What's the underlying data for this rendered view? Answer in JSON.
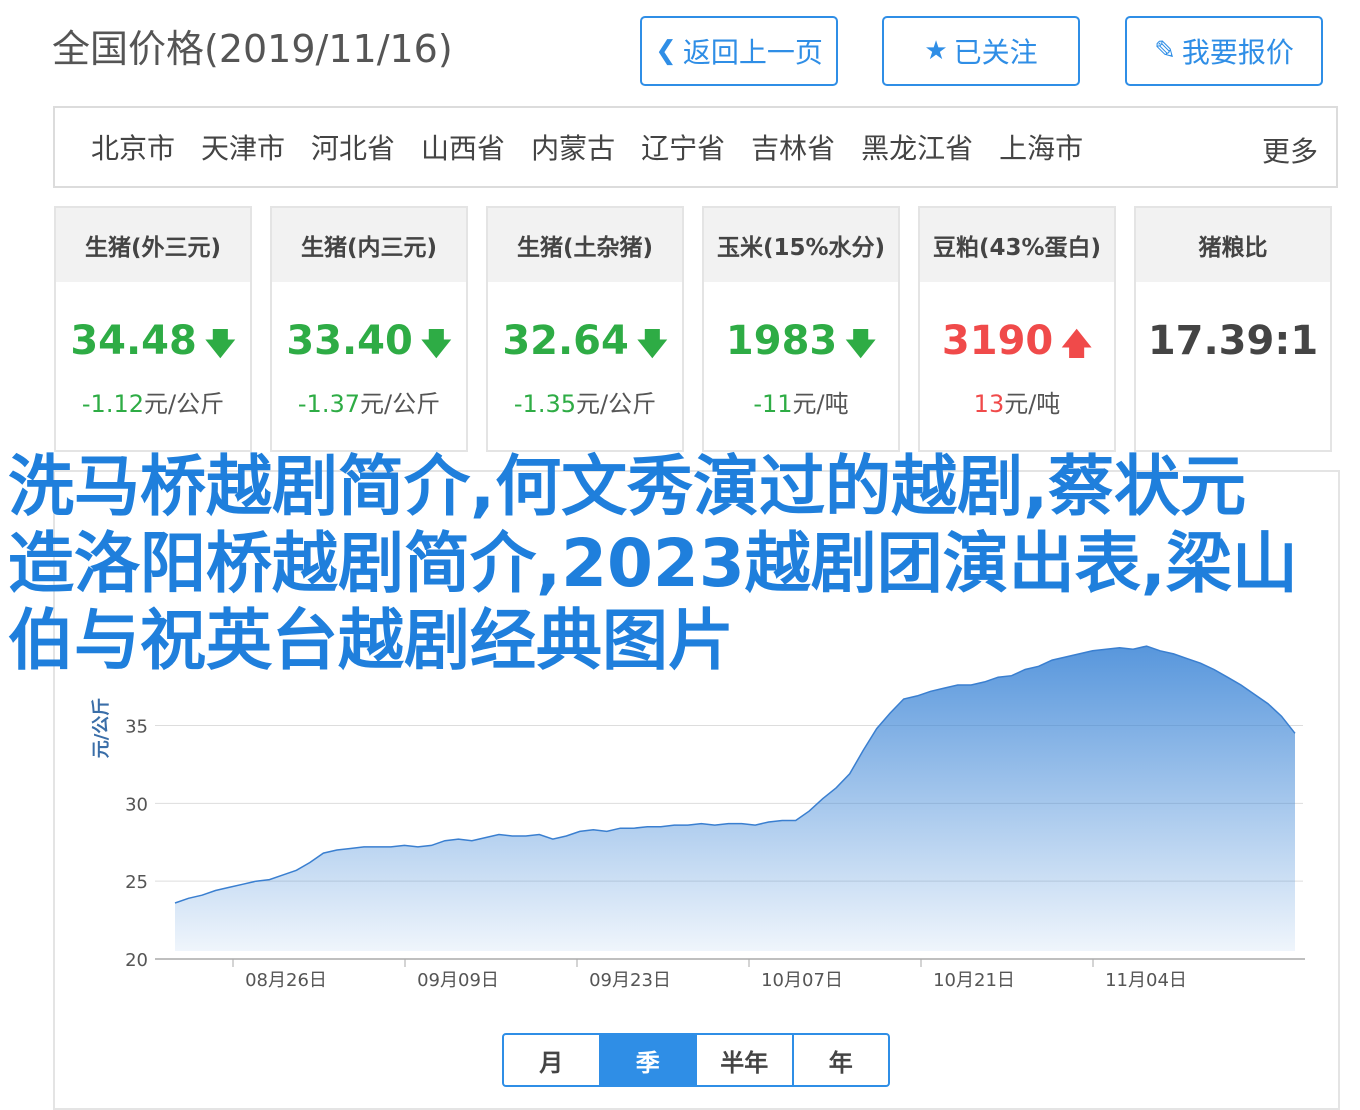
{
  "page": {
    "title": "全国价格(2019/11/16)"
  },
  "toolbar": {
    "back_label": "返回上一页",
    "follow_label": "已关注",
    "quote_label": "我要报价"
  },
  "regions": {
    "items": [
      "北京市",
      "天津市",
      "河北省",
      "山西省",
      "内蒙古",
      "辽宁省",
      "吉林省",
      "黑龙江省",
      "上海市"
    ],
    "more": "更多"
  },
  "cards": [
    {
      "name": "生猪(外三元)",
      "value": "34.48",
      "change": "-1.12",
      "unit": "元/公斤",
      "trend": "down"
    },
    {
      "name": "生猪(内三元)",
      "value": "33.40",
      "change": "-1.37",
      "unit": "元/公斤",
      "trend": "down"
    },
    {
      "name": "生猪(土杂猪)",
      "value": "32.64",
      "change": "-1.35",
      "unit": "元/公斤",
      "trend": "down"
    },
    {
      "name": "玉米(15%水分)",
      "value": "1983",
      "change": "-11",
      "unit": "元/吨",
      "trend": "down"
    },
    {
      "name": "豆粕(43%蛋白)",
      "value": "3190",
      "change": "13",
      "unit": "元/吨",
      "trend": "up"
    },
    {
      "name": "猪粮比",
      "value": "17.39:1",
      "change": "",
      "unit": "",
      "trend": "none"
    }
  ],
  "overlay_text": "洗马桥越剧简介,何文秀演过的越剧,蔡状元造洛阳桥越剧简介,2023越剧团演出表,梁山伯与祝英台越剧经典图片",
  "chart_data": {
    "type": "area",
    "ylabel": "元/公斤",
    "ylim": [
      20,
      50
    ],
    "yticks": [
      20,
      25,
      30,
      35
    ],
    "xticks": [
      "08月26日",
      "09月09日",
      "09月23日",
      "10月07日",
      "10月21日",
      "11月04日"
    ],
    "color": "#3a84d6",
    "values": [
      23.6,
      23.9,
      24.1,
      24.4,
      24.6,
      24.8,
      25.0,
      25.1,
      25.4,
      25.7,
      26.2,
      26.8,
      27.0,
      27.1,
      27.2,
      27.2,
      27.2,
      27.3,
      27.2,
      27.3,
      27.6,
      27.7,
      27.6,
      27.8,
      28.0,
      27.9,
      27.9,
      28.0,
      27.7,
      27.9,
      28.2,
      28.3,
      28.2,
      28.4,
      28.4,
      28.5,
      28.5,
      28.6,
      28.6,
      28.7,
      28.6,
      28.7,
      28.7,
      28.6,
      28.8,
      28.9,
      28.9,
      29.5,
      30.3,
      31.0,
      31.9,
      33.4,
      34.8,
      35.8,
      36.7,
      36.9,
      37.2,
      37.4,
      37.6,
      37.6,
      37.8,
      38.1,
      38.2,
      38.6,
      38.8,
      39.2,
      39.4,
      39.6,
      39.8,
      39.9,
      40.0,
      39.9,
      40.1,
      39.8,
      39.6,
      39.3,
      39.0,
      38.6,
      38.1,
      37.6,
      37.0,
      36.4,
      35.6,
      34.5
    ],
    "grid": true
  },
  "periods": {
    "items": [
      "月",
      "季",
      "半年",
      "年"
    ],
    "active": 1
  }
}
